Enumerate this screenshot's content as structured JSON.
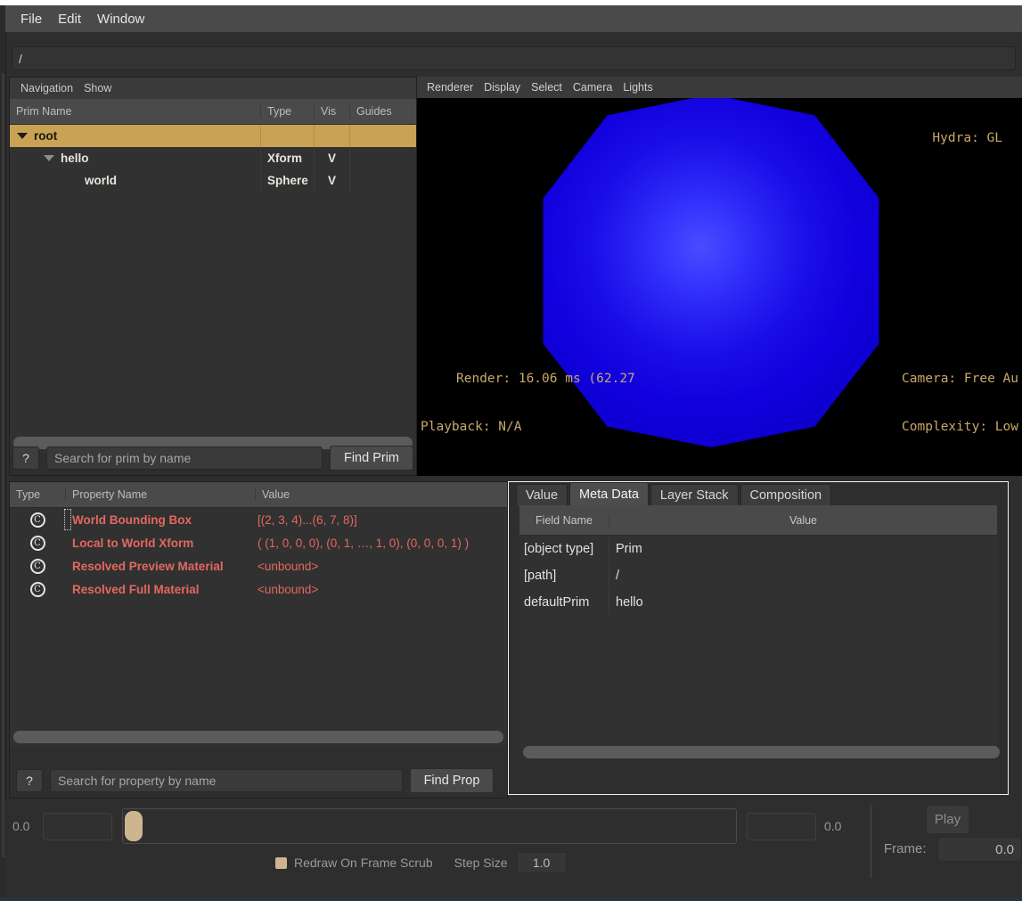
{
  "window": {
    "menubar": [
      "File",
      "Edit",
      "Window"
    ]
  },
  "pathbar": {
    "value": "/"
  },
  "tree": {
    "menus": [
      "Navigation",
      "Show"
    ],
    "columns": [
      "Prim Name",
      "Type",
      "Vis",
      "Guides"
    ],
    "rows": [
      {
        "name": "root",
        "type": "",
        "vis": "",
        "guides": "",
        "depth": 0,
        "expander": "open",
        "selected": true
      },
      {
        "name": "hello",
        "type": "Xform",
        "vis": "V",
        "guides": "",
        "depth": 1,
        "expander": "open-dim",
        "selected": false
      },
      {
        "name": "world",
        "type": "Sphere",
        "vis": "V",
        "guides": "",
        "depth": 2,
        "expander": "none",
        "selected": false
      }
    ],
    "search": {
      "help_label": "?",
      "placeholder": "Search for prim by name",
      "value": "",
      "find_label": "Find Prim"
    }
  },
  "viewport": {
    "menus": [
      "Renderer",
      "Display",
      "Select",
      "Camera",
      "Lights"
    ],
    "hud": {
      "hydra": "Hydra: GL",
      "render": "Render: 16.06 ms (62.27",
      "playback": "Playback: N/A",
      "camera": "Camera: Free Au",
      "complexity": "Complexity: Low"
    },
    "object_color": "#1a0ee8"
  },
  "properties": {
    "columns": [
      "Type",
      "Property Name",
      "Value"
    ],
    "rows": [
      {
        "icon": "composed-attribute-icon",
        "glyph": "C",
        "name": "World Bounding Box",
        "value": "[(2, 3, 4)...(6, 7, 8)]"
      },
      {
        "icon": "composed-attribute-icon",
        "glyph": "C",
        "name": "Local to World Xform",
        "value": "( (1, 0, 0, 0), (0, 1, …, 1, 0), (0, 0, 0, 1) )"
      },
      {
        "icon": "composed-attribute-icon",
        "glyph": "C",
        "name": "Resolved Preview Material",
        "value": "<unbound>"
      },
      {
        "icon": "composed-attribute-icon",
        "glyph": "C",
        "name": "Resolved Full Material",
        "value": "<unbound>"
      }
    ],
    "search": {
      "help_label": "?",
      "placeholder": "Search for property by name",
      "value": "",
      "find_label": "Find Prop"
    },
    "highlight_color": "#e4685f"
  },
  "inspector": {
    "tabs": [
      {
        "label": "Value",
        "active": false
      },
      {
        "label": "Meta Data",
        "active": true
      },
      {
        "label": "Layer Stack",
        "active": false
      },
      {
        "label": "Composition",
        "active": false
      }
    ],
    "columns": [
      "Field Name",
      "Value"
    ],
    "rows": [
      {
        "field": "[object type]",
        "value": "Prim"
      },
      {
        "field": "[path]",
        "value": "/"
      },
      {
        "field": "defaultPrim",
        "value": "hello"
      }
    ]
  },
  "timeline": {
    "start_label": "0.0",
    "start_value": "",
    "end_value": "",
    "end_label": "0.0",
    "redraw_label": "Redraw On Frame Scrub",
    "redraw_checked": true,
    "step_size_label": "Step Size",
    "step_size_value": "1.0",
    "play_label": "Play",
    "frame_label": "Frame:",
    "frame_value": "0.0",
    "handle_color": "#cdb68f"
  },
  "theme": {
    "selection_gold": "#c9a253",
    "hud_gold": "#c9a86a",
    "panel_bg": "#2e2e2e",
    "header_bg": "#4a4a4a"
  }
}
